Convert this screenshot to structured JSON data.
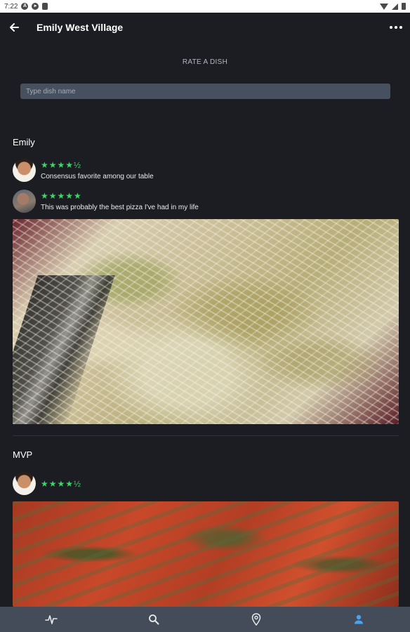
{
  "status_bar": {
    "time": "7:22"
  },
  "header": {
    "title": "Emily West Village"
  },
  "rate": {
    "label": "RATE A DISH",
    "search_placeholder": "Type dish name"
  },
  "dishes": [
    {
      "name": "Emily",
      "reviews": [
        {
          "stars": "★★★★½",
          "rating": 4.5,
          "comment": "Consensus favorite among our table"
        },
        {
          "stars": "★★★★★",
          "rating": 5,
          "comment": "This was probably the best pizza I've had in my life"
        }
      ]
    },
    {
      "name": "MVP",
      "reviews": [
        {
          "stars": "★★★★½",
          "rating": 4.5,
          "comment": ""
        }
      ]
    }
  ],
  "bottom_nav": {
    "items": [
      "activity",
      "search",
      "location",
      "profile"
    ],
    "active": "profile",
    "active_color": "#4aa3f0",
    "inactive_color": "#e6e9ee"
  },
  "colors": {
    "background": "#1b1d22",
    "star": "#3fd46a",
    "search_bg": "#46505e",
    "nav_bg": "#434c58"
  }
}
